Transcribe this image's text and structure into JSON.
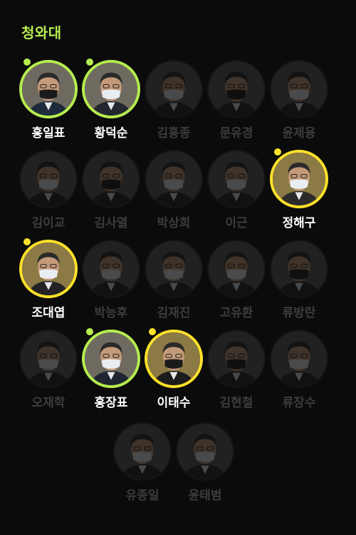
{
  "header": {
    "title": "청와대"
  },
  "colors": {
    "accent_green": "#b6ec4f",
    "accent_yellow": "#ffe12a",
    "inactive_text": "#3c3c3c",
    "active_text": "#ffffff",
    "background": "#0b0b0b"
  },
  "people": [
    {
      "name": "홍일표",
      "active": true,
      "ring": "green",
      "suit": "#1d2b3a",
      "mask": "black"
    },
    {
      "name": "황덕순",
      "active": true,
      "ring": "green",
      "suit": "#22262e",
      "mask": "white"
    },
    {
      "name": "김흥종",
      "active": false,
      "ring": "none",
      "suit": "#222",
      "mask": "white"
    },
    {
      "name": "문유경",
      "active": false,
      "ring": "none",
      "suit": "#222",
      "mask": "black"
    },
    {
      "name": "윤제용",
      "active": false,
      "ring": "none",
      "suit": "#222",
      "mask": "white"
    },
    {
      "name": "김이교",
      "active": false,
      "ring": "none",
      "suit": "#222",
      "mask": "white"
    },
    {
      "name": "김사열",
      "active": false,
      "ring": "none",
      "suit": "#222",
      "mask": "black"
    },
    {
      "name": "박상희",
      "active": false,
      "ring": "none",
      "suit": "#222",
      "mask": "white"
    },
    {
      "name": "이근",
      "active": false,
      "ring": "none",
      "suit": "#222",
      "mask": "white"
    },
    {
      "name": "정해구",
      "active": true,
      "ring": "yellow",
      "suit": "#2b2b2b",
      "mask": "white"
    },
    {
      "name": "조대엽",
      "active": true,
      "ring": "yellow",
      "suit": "#232323",
      "mask": "white"
    },
    {
      "name": "박능후",
      "active": false,
      "ring": "none",
      "suit": "#222",
      "mask": "white"
    },
    {
      "name": "김재진",
      "active": false,
      "ring": "none",
      "suit": "#222",
      "mask": "white"
    },
    {
      "name": "고유환",
      "active": false,
      "ring": "none",
      "suit": "#222",
      "mask": "white"
    },
    {
      "name": "류방란",
      "active": false,
      "ring": "none",
      "suit": "#222",
      "mask": "black"
    },
    {
      "name": "오재학",
      "active": false,
      "ring": "none",
      "suit": "#222",
      "mask": "white"
    },
    {
      "name": "홍장표",
      "active": true,
      "ring": "green",
      "suit": "#1f2530",
      "mask": "white"
    },
    {
      "name": "이태수",
      "active": true,
      "ring": "yellow",
      "suit": "#1c1c1c",
      "mask": "black"
    },
    {
      "name": "김현철",
      "active": false,
      "ring": "none",
      "suit": "#222",
      "mask": "black"
    },
    {
      "name": "류장수",
      "active": false,
      "ring": "none",
      "suit": "#222",
      "mask": "white"
    },
    {
      "name": "유종일",
      "active": false,
      "ring": "none",
      "suit": "#222",
      "mask": "white"
    },
    {
      "name": "윤태범",
      "active": false,
      "ring": "none",
      "suit": "#222",
      "mask": "white"
    }
  ]
}
